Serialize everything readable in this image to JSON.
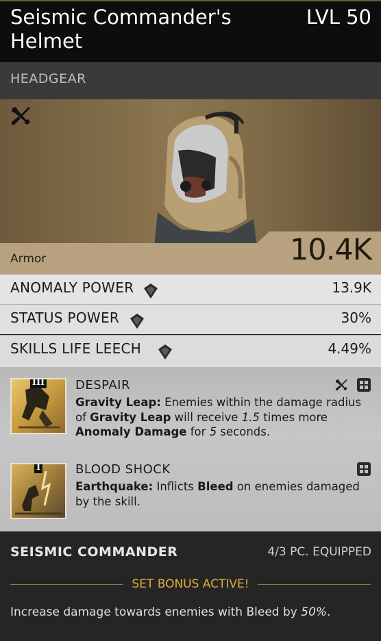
{
  "item": {
    "name": "Seismic Commander's Helmet",
    "level": "LVL 50",
    "slot": "HEADGEAR",
    "armor_label": "Armor",
    "armor_value": "10.4K"
  },
  "stats": [
    {
      "name": "ANOMALY POWER",
      "value": "13.9K",
      "icon": "gem-icon"
    },
    {
      "name": "STATUS POWER",
      "value": "30%",
      "icon": "gem-icon"
    },
    {
      "name": "SKILLS LIFE LEECH",
      "value": "4.49%",
      "icon": "gem-icon"
    }
  ],
  "mods": [
    {
      "tier": "III",
      "name": "DESPAIR",
      "skill": "Gravity Leap:",
      "t1": " Enemies within the damage radius of ",
      "b1": "Gravity Leap",
      "t2": " will receive ",
      "num1": "1.5",
      "t3": " times more ",
      "b2": "Anomaly Damage",
      "t4": " for ",
      "num2": "5",
      "t5": " seconds."
    },
    {
      "tier": "I",
      "name": "BLOOD SHOCK",
      "skill": "Earthquake:",
      "t1": " Inflicts ",
      "b1": "Bleed",
      "t2": " on enemies damaged by the skill."
    }
  ],
  "set": {
    "name": "SEISMIC COMMANDER",
    "equipped": "4/3 PC. EQUIPPED",
    "status": "SET BONUS ACTIVE!",
    "desc": "Increase damage towards enemies with Bleed by ",
    "value": "50%",
    "end": "."
  },
  "colors": {
    "accent": "#e2a93a",
    "armor_band": "#b8a17e",
    "header": "#0d0d0d"
  }
}
